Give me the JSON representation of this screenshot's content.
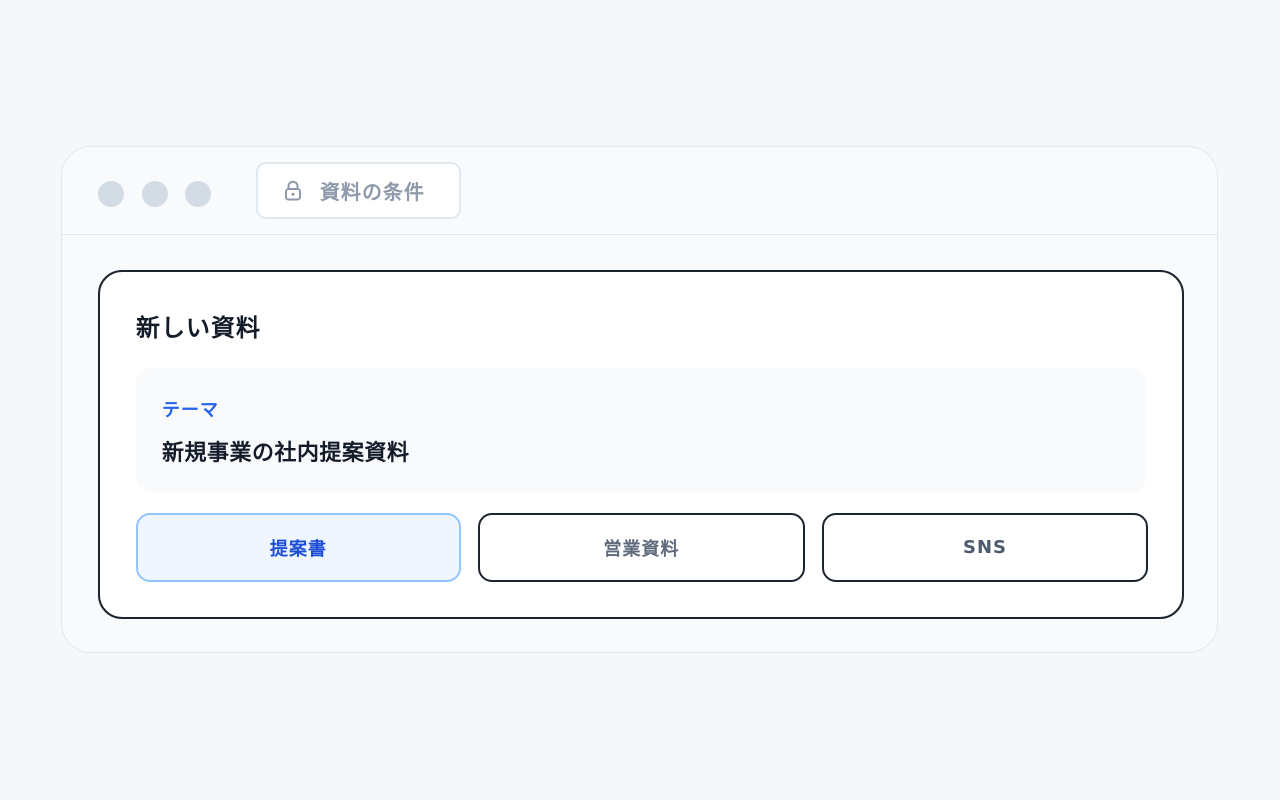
{
  "window": {
    "tab_title": "資料の条件",
    "tab_icon": "lock-icon"
  },
  "card": {
    "title": "新しい資料",
    "theme": {
      "label": "テーマ",
      "value": "新規事業の社内提案資料"
    },
    "options": [
      {
        "label": "提案書",
        "selected": true
      },
      {
        "label": "営業資料",
        "selected": false
      },
      {
        "label": "SNS",
        "selected": false
      }
    ]
  },
  "colors": {
    "accent": "#2463eb",
    "selected_bg": "#eff6ff",
    "selected_border": "#93c5fd",
    "card_border": "#1c2430",
    "page_bg": "#f5f8fb"
  }
}
